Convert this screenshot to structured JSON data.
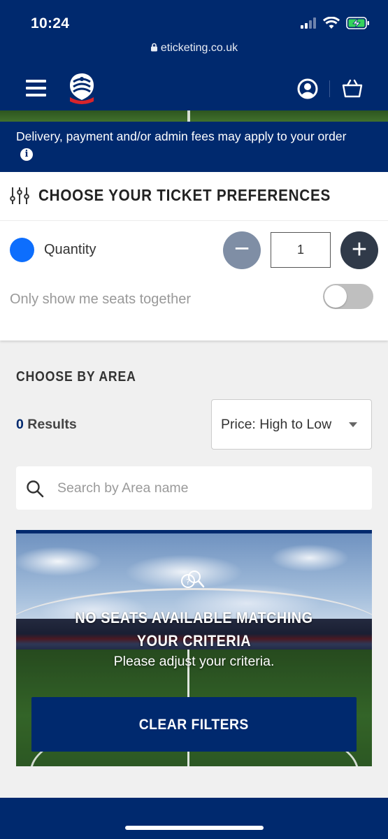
{
  "status_bar": {
    "time": "10:24",
    "url": "eticketing.co.uk"
  },
  "header": {
    "menu_icon": "hamburger-icon",
    "logo": "club-crest",
    "account_icon": "user-circle-icon",
    "basket_icon": "basket-icon"
  },
  "notice": {
    "text": "Delivery, payment and/or admin fees may apply to your order",
    "icon": "info-icon"
  },
  "preferences": {
    "title": "CHOOSE YOUR TICKET PREFERENCES",
    "quantity_label": "Quantity",
    "quantity_value": "1",
    "minus_symbol": "−",
    "plus_symbol": "+",
    "seats_together_label": "Only show me seats together",
    "seats_together_on": false
  },
  "area": {
    "title": "CHOOSE BY AREA",
    "results_count": "0",
    "results_label": "Results",
    "sort_value": "Price: High to Low",
    "search_placeholder": "Search by Area name"
  },
  "empty_state": {
    "title": "NO SEATS AVAILABLE MATCHING YOUR CRITERIA",
    "subtitle": "Please adjust your criteria.",
    "button_label": "CLEAR FILTERS"
  },
  "colors": {
    "primary": "#00296e",
    "accent_dot": "#0d6efd",
    "minus_btn": "#7f8ea5",
    "plus_btn": "#303a49"
  }
}
